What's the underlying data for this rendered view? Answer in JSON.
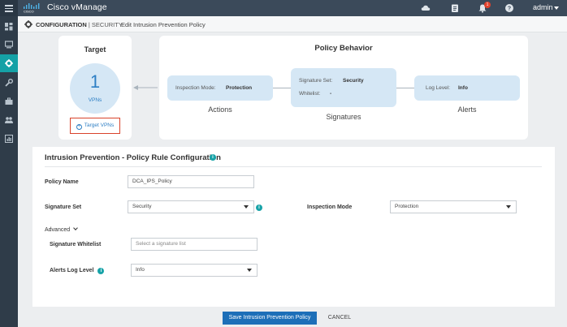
{
  "app": {
    "title": "Cisco vManage",
    "user": "admin",
    "notification_count": "1"
  },
  "breadcrumb": {
    "section": "CONFIGURATION",
    "subsection": "| SECURITY",
    "page": "Edit Intrusion Prevention Policy"
  },
  "target": {
    "title": "Target",
    "count": "1",
    "unit": "VPNs",
    "button_label": "Target VPNs"
  },
  "behavior": {
    "title": "Policy Behavior",
    "actions": {
      "label": "Actions",
      "key": "Inspection Mode:",
      "value": "Protection"
    },
    "signatures": {
      "label": "Signatures",
      "set_key": "Signature Set:",
      "set_value": "Security",
      "whitelist_key": "Whitelist:",
      "whitelist_value": "-"
    },
    "alerts": {
      "label": "Alerts",
      "key": "Log Level:",
      "value": "Info"
    }
  },
  "form": {
    "title": "Intrusion Prevention - Policy Rule Configuration",
    "policy_name_label": "Policy Name",
    "policy_name_value": "DCA_IPS_Policy",
    "signature_set_label": "Signature Set",
    "signature_set_value": "Security",
    "inspection_mode_label": "Inspection Mode",
    "inspection_mode_value": "Protection",
    "advanced_label": "Advanced",
    "whitelist_label": "Signature Whitelist",
    "whitelist_placeholder": "Select a signature list",
    "alerts_label": "Alerts Log Level",
    "alerts_value": "Info"
  },
  "footer": {
    "save_label": "Save Intrusion Prevention Policy",
    "cancel_label": "CANCEL"
  },
  "colors": {
    "topbar": "#3b4a5a",
    "sidebar": "#2f3c49",
    "accent": "#15a1a6",
    "primary": "#1d6fb8",
    "pill": "#d5e7f5",
    "highlight": "#d9432b"
  }
}
